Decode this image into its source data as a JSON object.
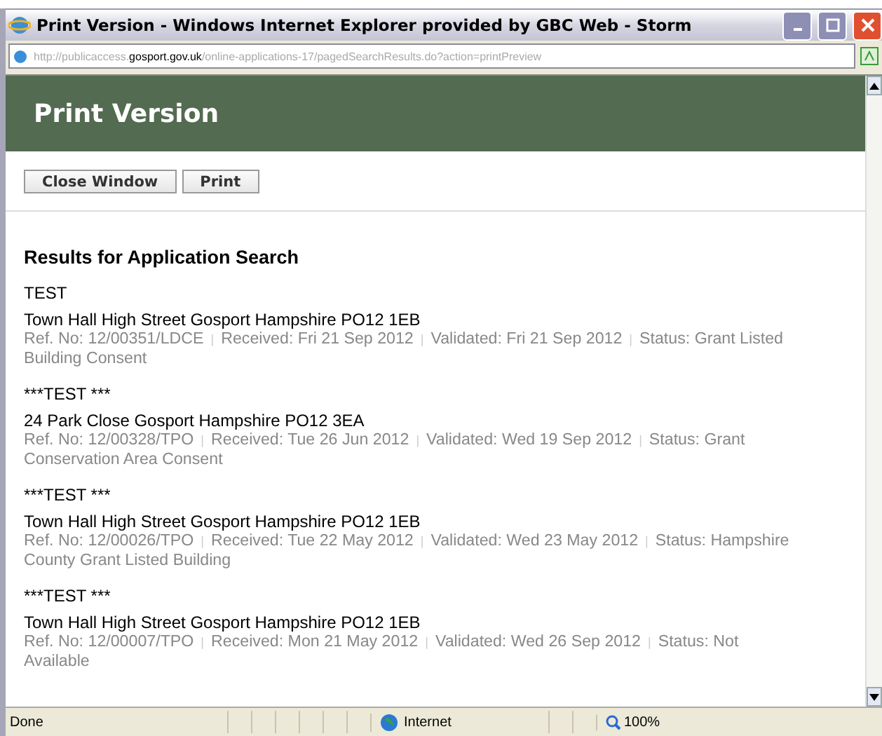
{
  "window": {
    "title": "Print Version - Windows Internet Explorer provided by GBC Web - Storm"
  },
  "address": {
    "prefix": "http://publicaccess.",
    "domain": "gosport.gov.uk",
    "path": "/online-applications-17/pagedSearchResults.do?action=printPreview"
  },
  "header": {
    "title": "Print Version"
  },
  "buttons": [
    "Close Window",
    "Print"
  ],
  "heading": "Results for Application Search",
  "separator": "|",
  "results": [
    {
      "title": "TEST",
      "address": "Town Hall High Street Gosport Hampshire PO12 1EB",
      "meta": [
        "Ref. No: 12/00351/LDCE",
        "Received: Fri 21 Sep 2012",
        "Validated: Fri 21 Sep 2012",
        "Status: Grant Listed Building Consent"
      ]
    },
    {
      "title": "***TEST ***",
      "address": "24 Park Close Gosport Hampshire PO12 3EA",
      "meta": [
        "Ref. No: 12/00328/TPO",
        "Received: Tue 26 Jun 2012",
        "Validated: Wed 19 Sep 2012",
        "Status: Grant Conservation Area Consent"
      ]
    },
    {
      "title": "***TEST ***",
      "address": "Town Hall High Street Gosport Hampshire PO12 1EB",
      "meta": [
        "Ref. No: 12/00026/TPO",
        "Received: Tue 22 May 2012",
        "Validated: Wed 23 May 2012",
        "Status: Hampshire County Grant Listed Building"
      ]
    },
    {
      "title": "***TEST ***",
      "address": "Town Hall High Street Gosport Hampshire PO12 1EB",
      "meta": [
        "Ref. No: 12/00007/TPO",
        "Received: Mon 21 May 2012",
        "Validated: Wed 26 Sep 2012",
        "Status: Not Available"
      ]
    }
  ],
  "status_bar": {
    "text": "Done",
    "zone": "Internet",
    "zoom": "100%"
  }
}
